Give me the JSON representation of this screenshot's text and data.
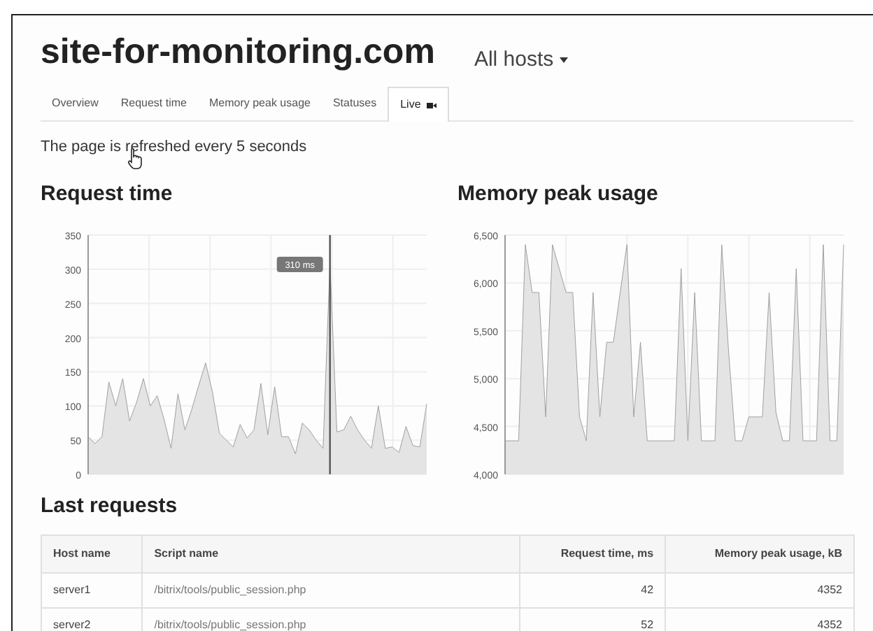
{
  "header": {
    "title": "site-for-monitoring.com",
    "host_menu": "All hosts"
  },
  "tabs": [
    {
      "label": "Overview",
      "selected": false
    },
    {
      "label": "Request time",
      "selected": false
    },
    {
      "label": "Memory peak usage",
      "selected": false
    },
    {
      "label": "Statuses",
      "selected": false
    },
    {
      "label": "Live",
      "selected": true,
      "kind": "live"
    }
  ],
  "notice": "The page is refreshed every 5 seconds",
  "charts": [
    {
      "title": "Request time",
      "chart_data": {
        "type": "area",
        "ylim": [
          0,
          350
        ],
        "yticks": [
          0,
          50,
          100,
          150,
          200,
          250,
          300,
          350
        ],
        "values": [
          55,
          45,
          55,
          135,
          100,
          140,
          78,
          105,
          140,
          100,
          115,
          80,
          38,
          118,
          65,
          95,
          130,
          163,
          120,
          60,
          50,
          40,
          73,
          53,
          65,
          133,
          58,
          128,
          55,
          55,
          30,
          75,
          65,
          50,
          38,
          310,
          62,
          65,
          85,
          65,
          50,
          38,
          100,
          38,
          40,
          32,
          70,
          42,
          40,
          103
        ],
        "grid": true,
        "annotations": [
          {
            "text": "310 ms"
          }
        ]
      }
    },
    {
      "title": "Memory peak usage",
      "chart_data": {
        "type": "area",
        "grid": true,
        "ylim": [
          4000,
          6500
        ],
        "yticks": [
          {
            "value": 4000,
            "label": "4,000"
          },
          {
            "value": 4500,
            "label": "4,500"
          },
          {
            "value": 5000,
            "label": "5,000"
          },
          {
            "value": 5500,
            "label": "5,500"
          },
          {
            "value": 6000,
            "label": "6,000"
          },
          {
            "value": 6500,
            "label": "6,500"
          }
        ],
        "values": [
          4350,
          4350,
          4350,
          6400,
          5900,
          5900,
          4600,
          6400,
          6150,
          5900,
          5900,
          4600,
          4350,
          5900,
          4600,
          5380,
          5380,
          5900,
          6400,
          4600,
          5380,
          4350,
          4350,
          4350,
          4350,
          4350,
          6150,
          4350,
          5900,
          4350,
          4350,
          4350,
          6400,
          5300,
          4350,
          4350,
          4600,
          4600,
          4600,
          5900,
          4650,
          4350,
          4350,
          6150,
          4350,
          4350,
          4350,
          6400,
          4350,
          4350,
          6400
        ]
      }
    }
  ],
  "table": {
    "title": "Last requests",
    "columns": [
      "Host name",
      "Script name",
      "Request time, ms",
      "Memory peak usage, kB"
    ],
    "rows": [
      [
        "server1",
        "/bitrix/tools/public_session.php",
        "42",
        "4352"
      ],
      [
        "server2",
        "/bitrix/tools/public_session.php",
        "52",
        "4352"
      ]
    ]
  }
}
